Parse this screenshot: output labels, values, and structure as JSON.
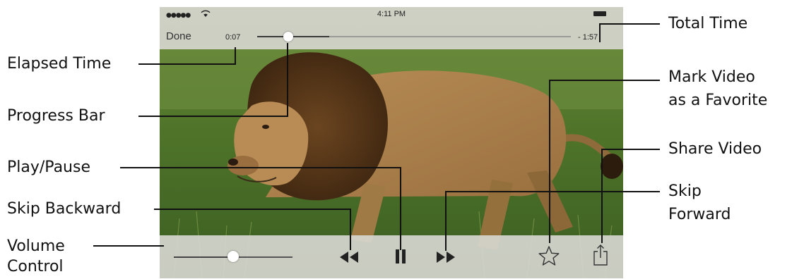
{
  "status_bar": {
    "signal": "●●●●●",
    "time": "4:11 PM"
  },
  "player": {
    "done_label": "Done",
    "elapsed_time": "0:07",
    "remaining_time": "- 1:57",
    "progress_fraction": 0.1,
    "buffered_fraction": 0.23,
    "volume_fraction": 0.5
  },
  "controls": {
    "skip_backward_icon": "skip-backward-icon",
    "play_pause_icon": "pause-icon",
    "skip_forward_icon": "skip-forward-icon",
    "favorite_icon": "star-icon",
    "share_icon": "share-icon"
  },
  "callouts": {
    "elapsed_time": "Elapsed Time",
    "progress_bar": "Progress Bar",
    "play_pause": "Play/Pause",
    "skip_backward": "Skip Backward",
    "volume_line1": "Volume",
    "volume_line2": "Control",
    "total_time": "Total Time",
    "favorite_line1": "Mark Video",
    "favorite_line2": "as a Favorite",
    "share_video": "Share Video",
    "skip_forward_line1": "Skip",
    "skip_forward_line2": "Forward"
  }
}
